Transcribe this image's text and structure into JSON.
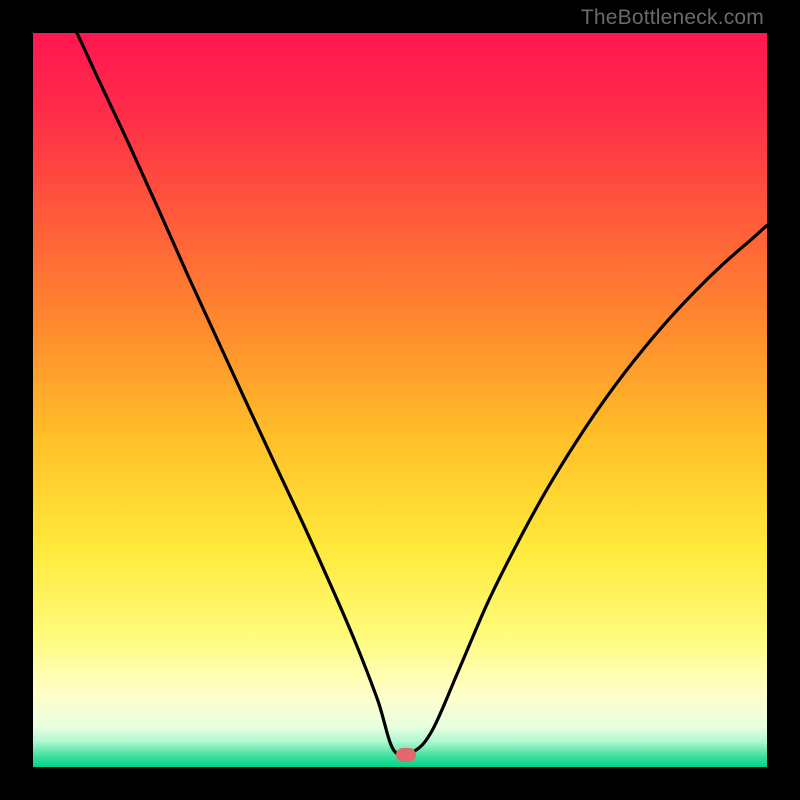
{
  "watermark": "TheBottleneck.com",
  "marker": {
    "x_frac": 0.508,
    "y_frac": 0.984,
    "color": "#e06a6b"
  },
  "gradient_stops": [
    {
      "offset": 0.0,
      "color": "#ff1750"
    },
    {
      "offset": 0.1,
      "color": "#ff2a4a"
    },
    {
      "offset": 0.25,
      "color": "#ff5a3a"
    },
    {
      "offset": 0.4,
      "color": "#ff8a2e"
    },
    {
      "offset": 0.55,
      "color": "#ffbf28"
    },
    {
      "offset": 0.7,
      "color": "#ffe93a"
    },
    {
      "offset": 0.82,
      "color": "#fffb7a"
    },
    {
      "offset": 0.9,
      "color": "#ffffc8"
    },
    {
      "offset": 0.945,
      "color": "#e8ffe0"
    },
    {
      "offset": 0.965,
      "color": "#b0f8d0"
    },
    {
      "offset": 0.985,
      "color": "#40e0a0"
    },
    {
      "offset": 1.0,
      "color": "#00d488"
    }
  ],
  "chart_data": {
    "type": "line",
    "title": "",
    "xlabel": "",
    "ylabel": "",
    "xlim": [
      0,
      1
    ],
    "ylim": [
      0,
      1
    ],
    "series": [
      {
        "name": "bottleneck-curve",
        "x": [
          0.06,
          0.09,
          0.13,
          0.17,
          0.21,
          0.25,
          0.29,
          0.33,
          0.37,
          0.41,
          0.44,
          0.47,
          0.492,
          0.52,
          0.545,
          0.58,
          0.62,
          0.66,
          0.7,
          0.74,
          0.78,
          0.82,
          0.86,
          0.9,
          0.94,
          0.98,
          1.0
        ],
        "y": [
          1.0,
          0.935,
          0.85,
          0.762,
          0.672,
          0.585,
          0.498,
          0.412,
          0.327,
          0.238,
          0.168,
          0.09,
          0.022,
          0.022,
          0.052,
          0.132,
          0.225,
          0.305,
          0.378,
          0.443,
          0.502,
          0.555,
          0.603,
          0.646,
          0.685,
          0.72,
          0.738
        ]
      }
    ],
    "annotations": [
      {
        "type": "marker",
        "x": 0.508,
        "y": 0.016,
        "label": "optimal-point"
      }
    ]
  }
}
